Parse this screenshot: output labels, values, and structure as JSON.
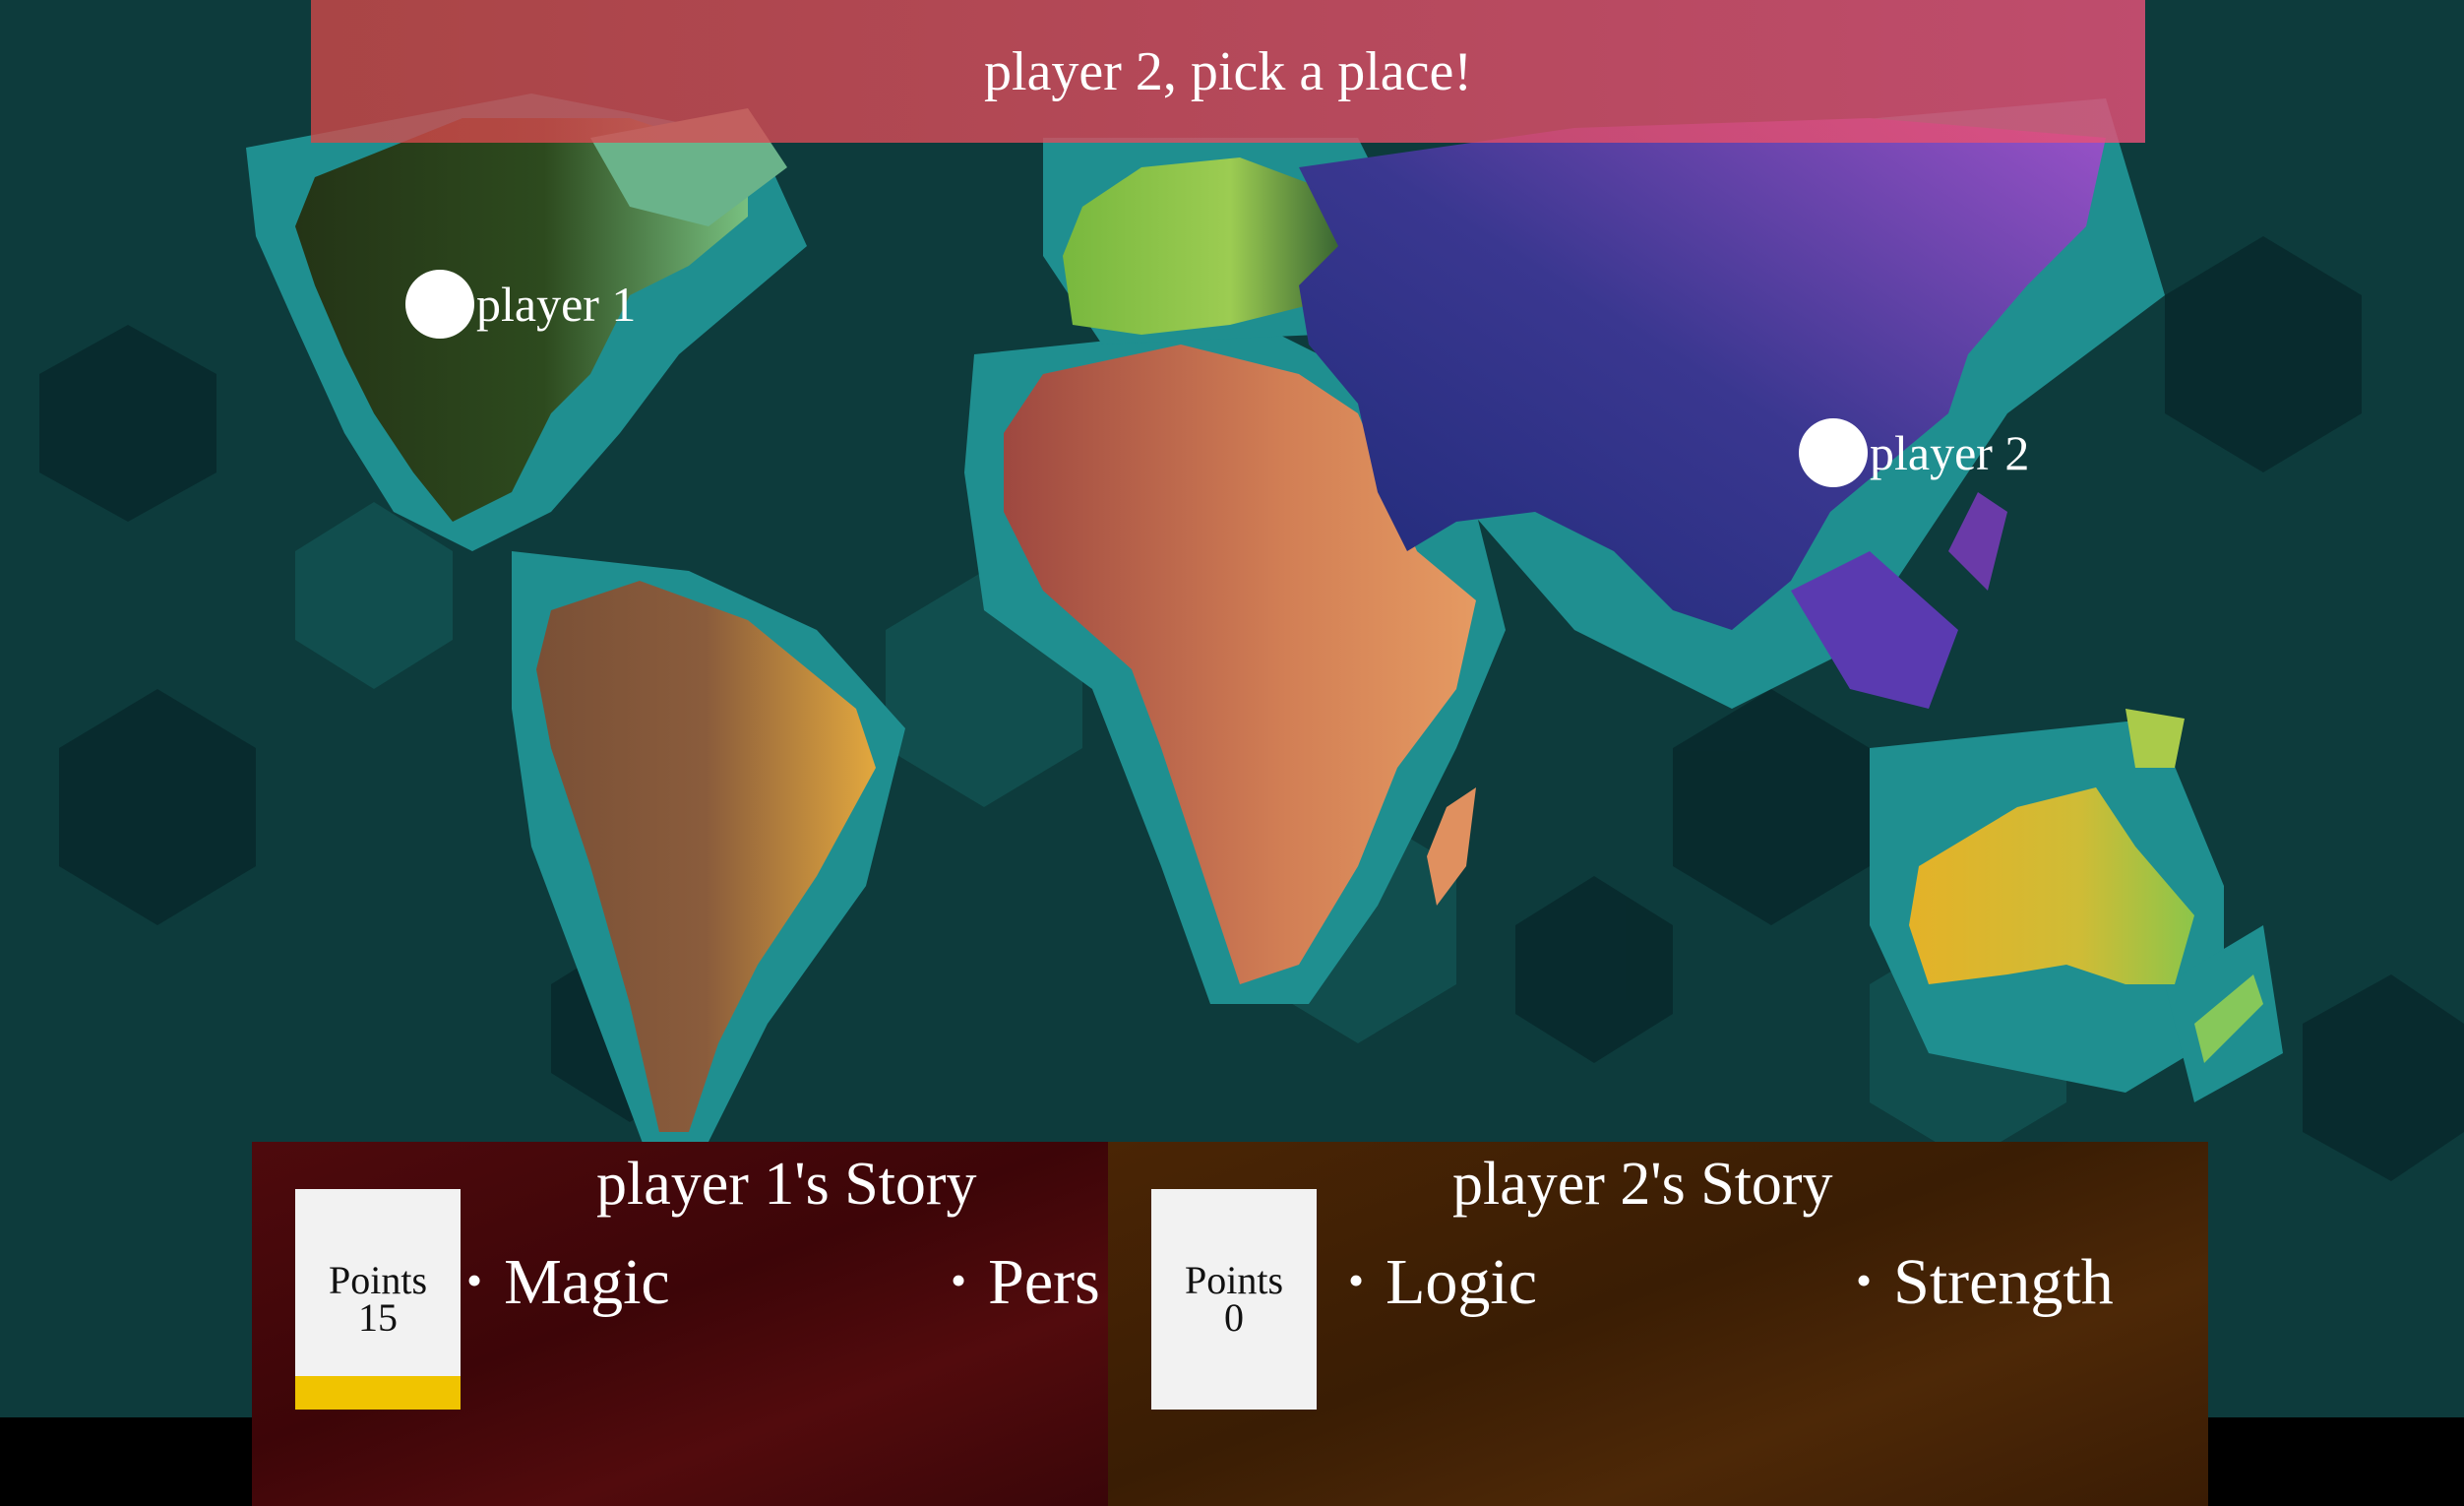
{
  "banner": {
    "text": "player 2, pick a place!"
  },
  "markers": [
    {
      "label": "player 1"
    },
    {
      "label": "player 2"
    }
  ],
  "players": [
    {
      "story_title": "player 1's Story",
      "points_label": "Points",
      "points": "15",
      "traits": [
        "Magic",
        "Pers"
      ],
      "color": "#4b0a0c",
      "bar_color": "#f0c400"
    },
    {
      "story_title": "player 2's Story",
      "points_label": "Points",
      "points": "0",
      "traits": [
        "Logic",
        "Strength"
      ],
      "color": "#3f2005"
    }
  ],
  "map_colors": {
    "ocean_dark": "#0b3a3b",
    "ocean_mid": "#185c5b",
    "coast": "#22999a",
    "north_america": "#2a3a16",
    "south_america": "#d9a340",
    "africa": "#df8f5e",
    "europe": "#8cc44a",
    "asia": "#6a3aa8",
    "australia": "#e0b82e"
  }
}
